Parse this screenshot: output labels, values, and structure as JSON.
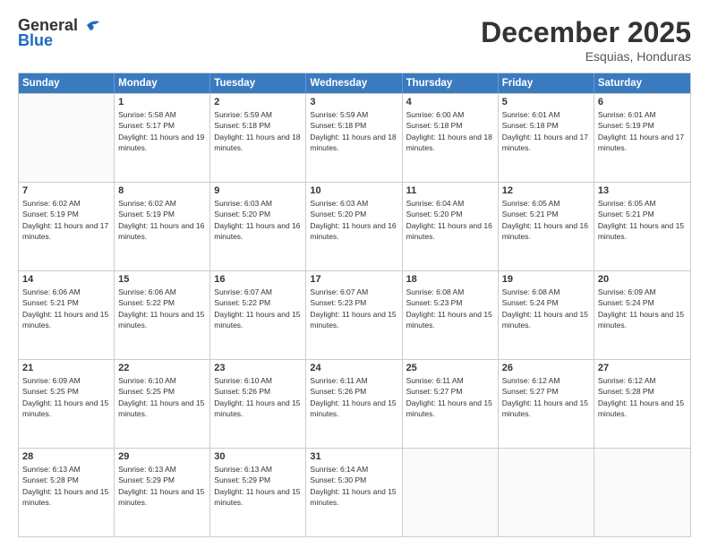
{
  "logo": {
    "general": "General",
    "blue": "Blue"
  },
  "title": "December 2025",
  "subtitle": "Esquias, Honduras",
  "header_days": [
    "Sunday",
    "Monday",
    "Tuesday",
    "Wednesday",
    "Thursday",
    "Friday",
    "Saturday"
  ],
  "weeks": [
    [
      {
        "day": "",
        "sunrise": "",
        "sunset": "",
        "daylight": ""
      },
      {
        "day": "1",
        "sunrise": "Sunrise: 5:58 AM",
        "sunset": "Sunset: 5:17 PM",
        "daylight": "Daylight: 11 hours and 19 minutes."
      },
      {
        "day": "2",
        "sunrise": "Sunrise: 5:59 AM",
        "sunset": "Sunset: 5:18 PM",
        "daylight": "Daylight: 11 hours and 18 minutes."
      },
      {
        "day": "3",
        "sunrise": "Sunrise: 5:59 AM",
        "sunset": "Sunset: 5:18 PM",
        "daylight": "Daylight: 11 hours and 18 minutes."
      },
      {
        "day": "4",
        "sunrise": "Sunrise: 6:00 AM",
        "sunset": "Sunset: 5:18 PM",
        "daylight": "Daylight: 11 hours and 18 minutes."
      },
      {
        "day": "5",
        "sunrise": "Sunrise: 6:01 AM",
        "sunset": "Sunset: 5:18 PM",
        "daylight": "Daylight: 11 hours and 17 minutes."
      },
      {
        "day": "6",
        "sunrise": "Sunrise: 6:01 AM",
        "sunset": "Sunset: 5:19 PM",
        "daylight": "Daylight: 11 hours and 17 minutes."
      }
    ],
    [
      {
        "day": "7",
        "sunrise": "Sunrise: 6:02 AM",
        "sunset": "Sunset: 5:19 PM",
        "daylight": "Daylight: 11 hours and 17 minutes."
      },
      {
        "day": "8",
        "sunrise": "Sunrise: 6:02 AM",
        "sunset": "Sunset: 5:19 PM",
        "daylight": "Daylight: 11 hours and 16 minutes."
      },
      {
        "day": "9",
        "sunrise": "Sunrise: 6:03 AM",
        "sunset": "Sunset: 5:20 PM",
        "daylight": "Daylight: 11 hours and 16 minutes."
      },
      {
        "day": "10",
        "sunrise": "Sunrise: 6:03 AM",
        "sunset": "Sunset: 5:20 PM",
        "daylight": "Daylight: 11 hours and 16 minutes."
      },
      {
        "day": "11",
        "sunrise": "Sunrise: 6:04 AM",
        "sunset": "Sunset: 5:20 PM",
        "daylight": "Daylight: 11 hours and 16 minutes."
      },
      {
        "day": "12",
        "sunrise": "Sunrise: 6:05 AM",
        "sunset": "Sunset: 5:21 PM",
        "daylight": "Daylight: 11 hours and 16 minutes."
      },
      {
        "day": "13",
        "sunrise": "Sunrise: 6:05 AM",
        "sunset": "Sunset: 5:21 PM",
        "daylight": "Daylight: 11 hours and 15 minutes."
      }
    ],
    [
      {
        "day": "14",
        "sunrise": "Sunrise: 6:06 AM",
        "sunset": "Sunset: 5:21 PM",
        "daylight": "Daylight: 11 hours and 15 minutes."
      },
      {
        "day": "15",
        "sunrise": "Sunrise: 6:06 AM",
        "sunset": "Sunset: 5:22 PM",
        "daylight": "Daylight: 11 hours and 15 minutes."
      },
      {
        "day": "16",
        "sunrise": "Sunrise: 6:07 AM",
        "sunset": "Sunset: 5:22 PM",
        "daylight": "Daylight: 11 hours and 15 minutes."
      },
      {
        "day": "17",
        "sunrise": "Sunrise: 6:07 AM",
        "sunset": "Sunset: 5:23 PM",
        "daylight": "Daylight: 11 hours and 15 minutes."
      },
      {
        "day": "18",
        "sunrise": "Sunrise: 6:08 AM",
        "sunset": "Sunset: 5:23 PM",
        "daylight": "Daylight: 11 hours and 15 minutes."
      },
      {
        "day": "19",
        "sunrise": "Sunrise: 6:08 AM",
        "sunset": "Sunset: 5:24 PM",
        "daylight": "Daylight: 11 hours and 15 minutes."
      },
      {
        "day": "20",
        "sunrise": "Sunrise: 6:09 AM",
        "sunset": "Sunset: 5:24 PM",
        "daylight": "Daylight: 11 hours and 15 minutes."
      }
    ],
    [
      {
        "day": "21",
        "sunrise": "Sunrise: 6:09 AM",
        "sunset": "Sunset: 5:25 PM",
        "daylight": "Daylight: 11 hours and 15 minutes."
      },
      {
        "day": "22",
        "sunrise": "Sunrise: 6:10 AM",
        "sunset": "Sunset: 5:25 PM",
        "daylight": "Daylight: 11 hours and 15 minutes."
      },
      {
        "day": "23",
        "sunrise": "Sunrise: 6:10 AM",
        "sunset": "Sunset: 5:26 PM",
        "daylight": "Daylight: 11 hours and 15 minutes."
      },
      {
        "day": "24",
        "sunrise": "Sunrise: 6:11 AM",
        "sunset": "Sunset: 5:26 PM",
        "daylight": "Daylight: 11 hours and 15 minutes."
      },
      {
        "day": "25",
        "sunrise": "Sunrise: 6:11 AM",
        "sunset": "Sunset: 5:27 PM",
        "daylight": "Daylight: 11 hours and 15 minutes."
      },
      {
        "day": "26",
        "sunrise": "Sunrise: 6:12 AM",
        "sunset": "Sunset: 5:27 PM",
        "daylight": "Daylight: 11 hours and 15 minutes."
      },
      {
        "day": "27",
        "sunrise": "Sunrise: 6:12 AM",
        "sunset": "Sunset: 5:28 PM",
        "daylight": "Daylight: 11 hours and 15 minutes."
      }
    ],
    [
      {
        "day": "28",
        "sunrise": "Sunrise: 6:13 AM",
        "sunset": "Sunset: 5:28 PM",
        "daylight": "Daylight: 11 hours and 15 minutes."
      },
      {
        "day": "29",
        "sunrise": "Sunrise: 6:13 AM",
        "sunset": "Sunset: 5:29 PM",
        "daylight": "Daylight: 11 hours and 15 minutes."
      },
      {
        "day": "30",
        "sunrise": "Sunrise: 6:13 AM",
        "sunset": "Sunset: 5:29 PM",
        "daylight": "Daylight: 11 hours and 15 minutes."
      },
      {
        "day": "31",
        "sunrise": "Sunrise: 6:14 AM",
        "sunset": "Sunset: 5:30 PM",
        "daylight": "Daylight: 11 hours and 15 minutes."
      },
      {
        "day": "",
        "sunrise": "",
        "sunset": "",
        "daylight": ""
      },
      {
        "day": "",
        "sunrise": "",
        "sunset": "",
        "daylight": ""
      },
      {
        "day": "",
        "sunrise": "",
        "sunset": "",
        "daylight": ""
      }
    ]
  ]
}
